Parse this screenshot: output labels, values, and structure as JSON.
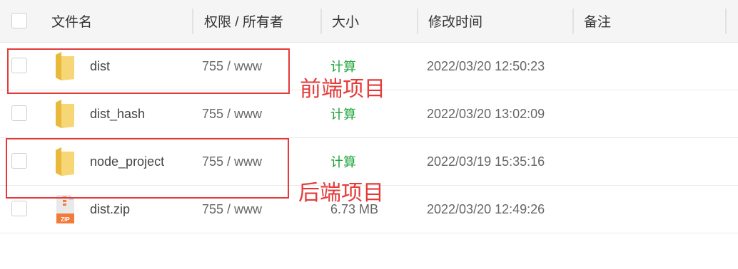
{
  "header": {
    "name": "文件名",
    "perm": "权限 / 所有者",
    "size": "大小",
    "mtime": "修改时间",
    "note": "备注"
  },
  "rows": [
    {
      "name": "dist",
      "perm": "755 / www",
      "size": "计算",
      "mtime": "2022/03/20 12:50:23",
      "icon": "folder-icon"
    },
    {
      "name": "dist_hash",
      "perm": "755 / www",
      "size": "计算",
      "mtime": "2022/03/20 13:02:09",
      "icon": "folder-icon"
    },
    {
      "name": "node_project",
      "perm": "755 / www",
      "size": "计算",
      "mtime": "2022/03/19 15:35:16",
      "icon": "folder-icon"
    },
    {
      "name": "dist.zip",
      "perm": "755 / www",
      "size": "6.73 MB",
      "mtime": "2022/03/20 12:49:26",
      "icon": "zip-file-icon"
    }
  ],
  "annotations": {
    "frontend": "前端项目",
    "backend": "后端项目"
  },
  "colors": {
    "calc_link": "#20a53a",
    "annotation": "#e53a3a",
    "folder": "#f7d676"
  },
  "icons": {
    "zip_label": "ZIP"
  }
}
